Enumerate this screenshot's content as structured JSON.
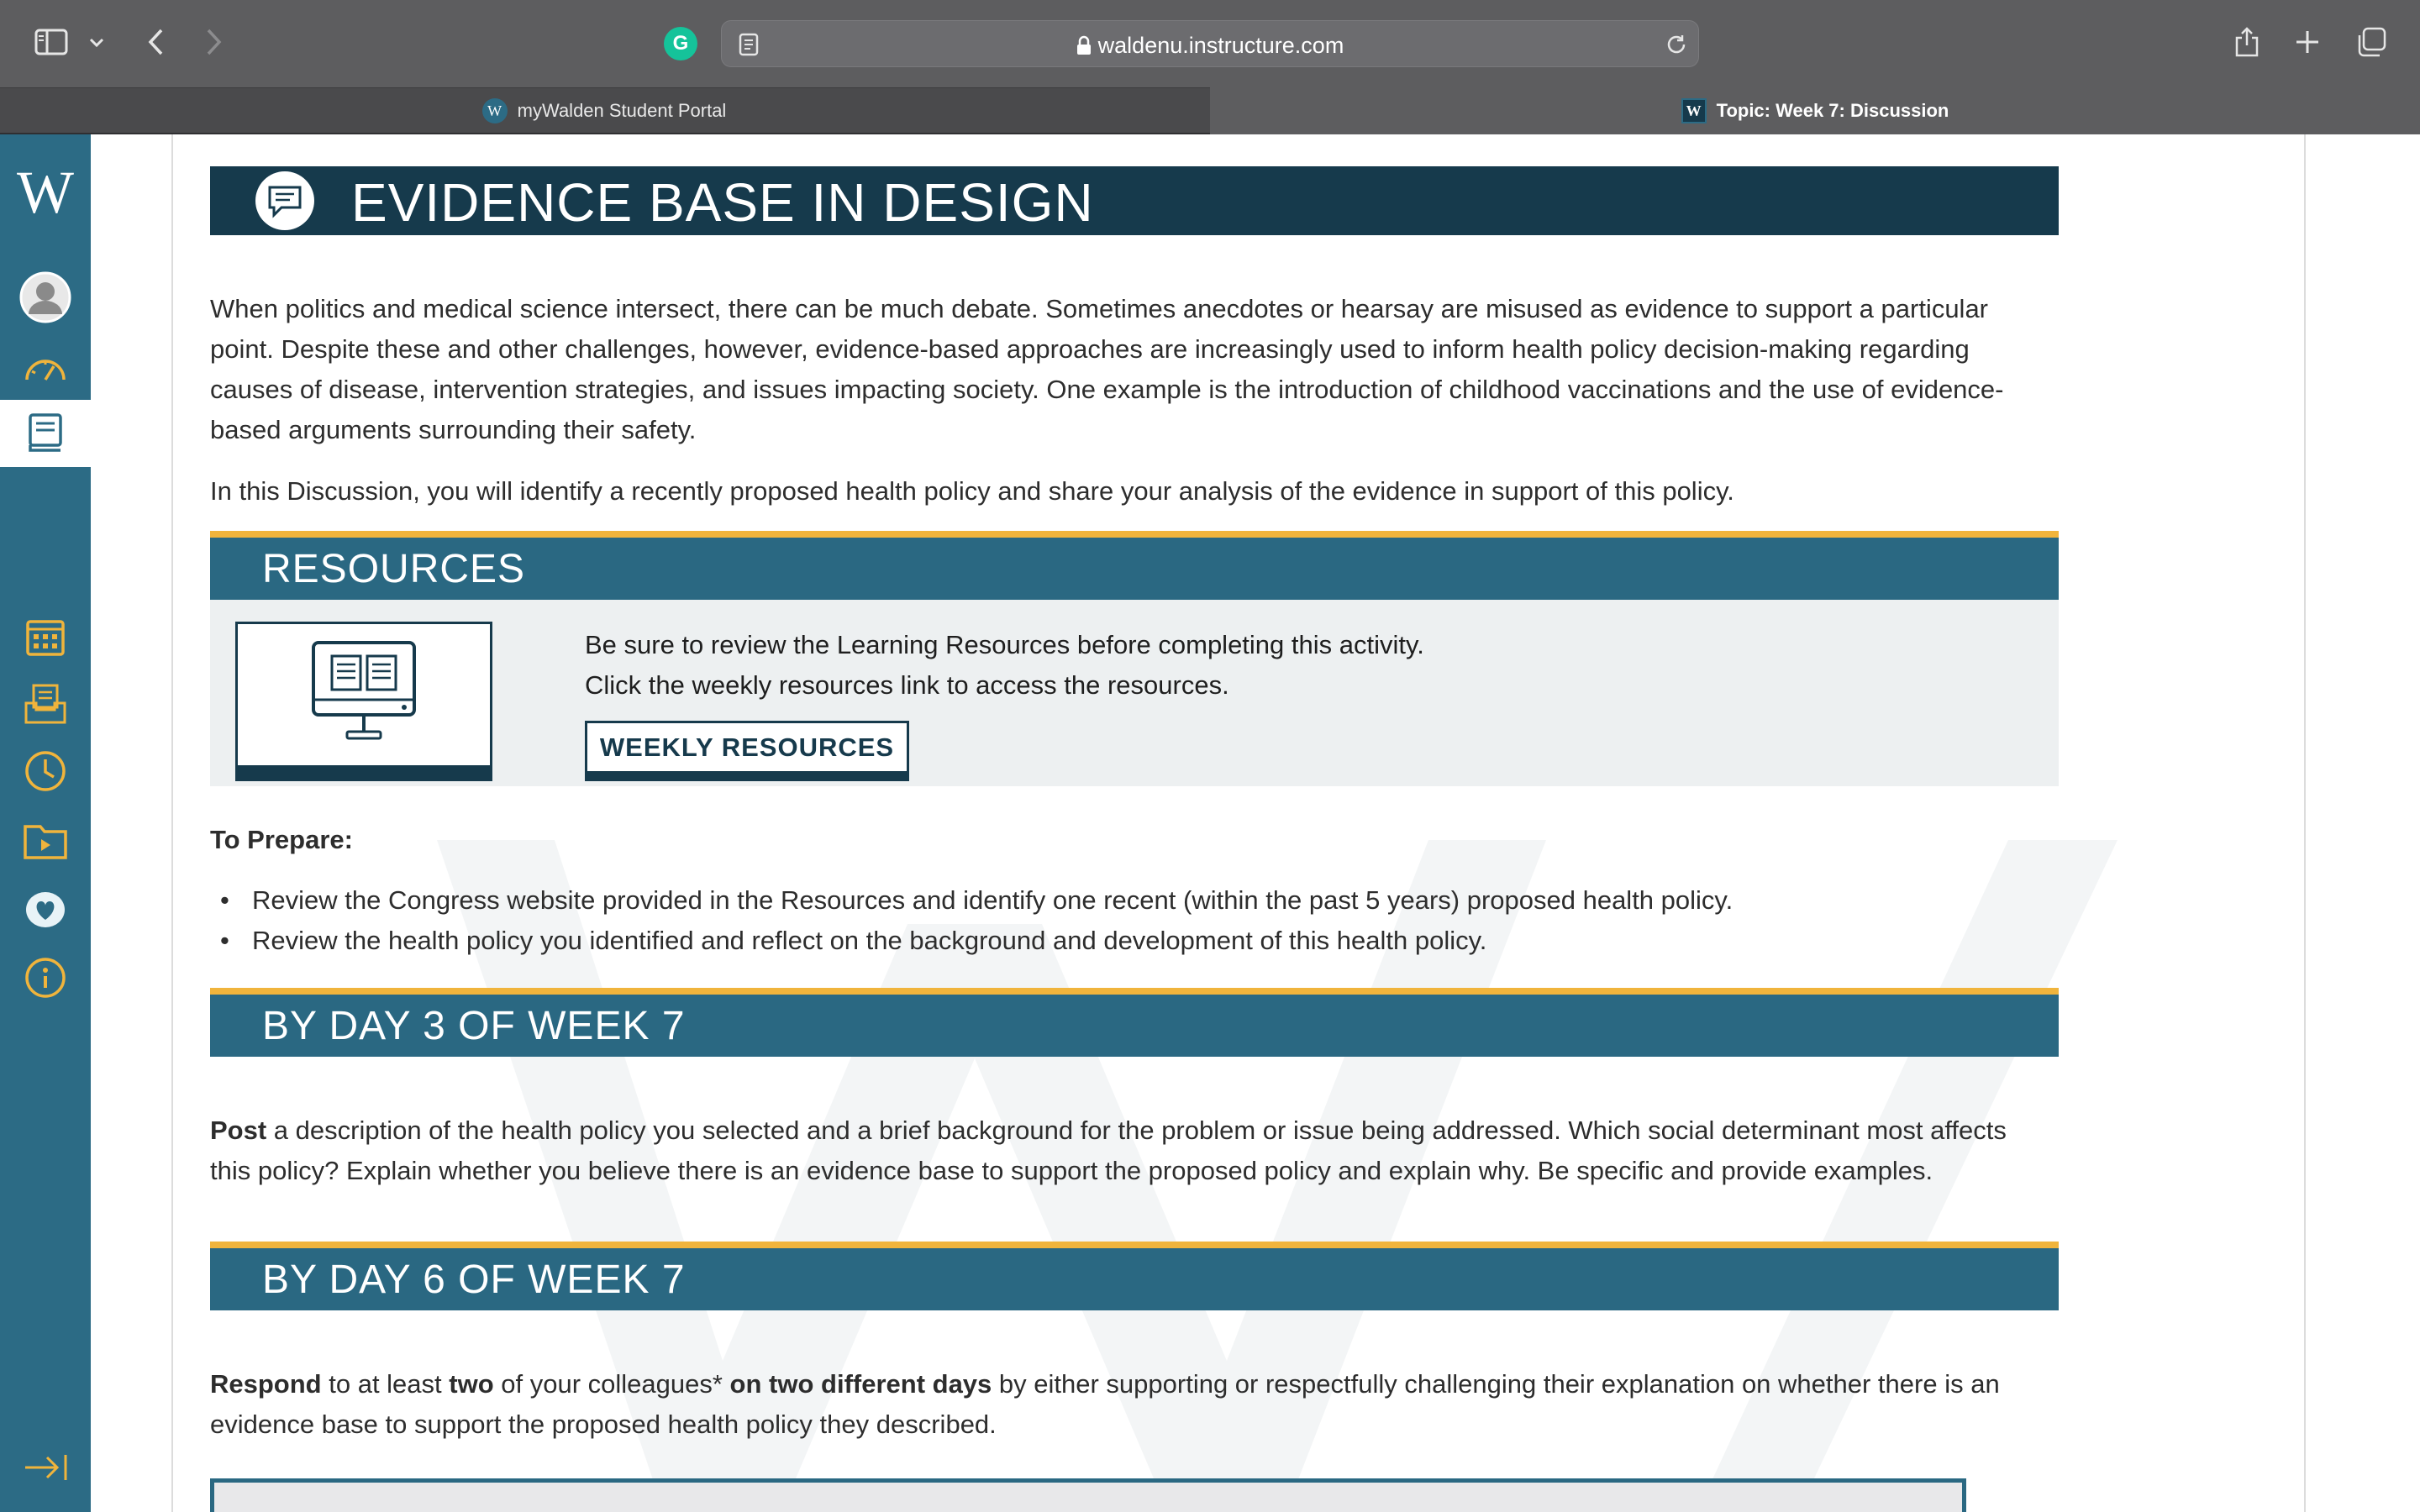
{
  "browser": {
    "url": "waldenu.instructure.com",
    "tabs": [
      {
        "label": "myWalden Student Portal",
        "active": false
      },
      {
        "label": "Topic: Week 7: Discussion",
        "active": true
      }
    ]
  },
  "sidebar": {
    "logo": "W",
    "items": [
      {
        "name": "account-icon"
      },
      {
        "name": "dashboard-icon"
      },
      {
        "name": "courses-icon",
        "active": true
      },
      {
        "name": "calendar-icon"
      },
      {
        "name": "inbox-icon"
      },
      {
        "name": "history-icon"
      },
      {
        "name": "media-icon"
      },
      {
        "name": "wellness-icon"
      },
      {
        "name": "help-icon"
      }
    ],
    "accent_color": "#2c6b85",
    "icon_color": "#f0b43c"
  },
  "content": {
    "title": "EVIDENCE BASE IN DESIGN",
    "intro_lines": [
      "When politics and medical science intersect, there can be much debate. Sometimes anecdotes or hearsay are misused as evidence to support a particular",
      "point. Despite these and other challenges, however, evidence-based approaches are increasingly used to inform health policy decision-making regarding",
      "causes of disease, intervention strategies, and issues impacting society. One example is the introduction of childhood vaccinations and the use of evidence-",
      "based arguments surrounding their safety."
    ],
    "discussion_intro": "In this Discussion, you will identify a recently proposed health policy and share your analysis of the evidence in support of this policy.",
    "resources": {
      "heading": "RESOURCES",
      "line1": "Be sure to review the Learning Resources before completing this activity.",
      "line2": "Click the weekly resources link to access the resources.",
      "button": "WEEKLY RESOURCES"
    },
    "prepare": {
      "heading": "To Prepare:",
      "items": [
        "Review the Congress website provided in the Resources and identify one recent (within the past 5 years) proposed health policy.",
        "Review the health policy you identified and reflect on the background and development of this health policy."
      ]
    },
    "day3": {
      "heading": "BY DAY 3 OF WEEK 7",
      "lead": "Post",
      "line1": " a description of the health policy you selected and a brief background for the problem or issue being addressed. Which social determinant most affects",
      "line2": "this policy? Explain whether you believe there is an evidence base to support the proposed policy and explain why. Be specific and provide examples."
    },
    "day6": {
      "heading": "BY DAY 6 OF WEEK 7",
      "lead": "Respond",
      "text_a": " to at least ",
      "bold_b": "two",
      "text_c": " of your colleagues* ",
      "bold_d": "on two different days",
      "text_e": " by either supporting or respectfully challenging their explanation on whether there is an",
      "line2": "evidence base to support the proposed health policy they described."
    }
  }
}
